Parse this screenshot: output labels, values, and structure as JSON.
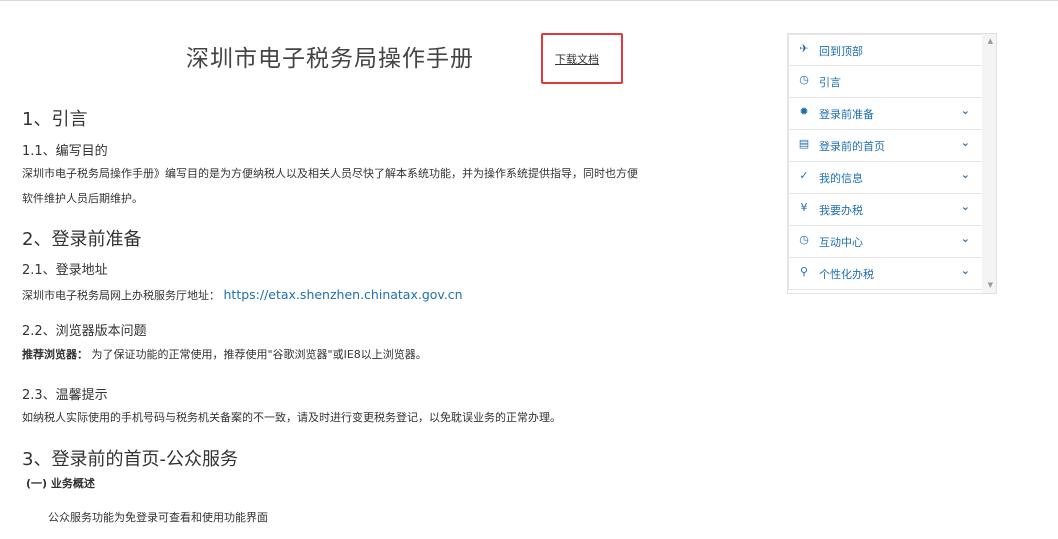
{
  "doc": {
    "title": "深圳市电子税务局操作手册",
    "download_label": "下载文档"
  },
  "sections": {
    "s1": "1、引言",
    "s1_1": "1.1、编写目的",
    "s1_1_text_line1": "深圳市电子税务局操作手册》编写目的是为方便纳税人以及相关人员尽快了解本系统功能，并为操作系统提供指导，同时也方便",
    "s1_1_text_line2": "软件维护人员后期维护。",
    "s2": "2、登录前准备",
    "s2_1": "2.1、登录地址",
    "s2_1_prefix": "深圳市电子税务局网上办税服务厅地址：",
    "s2_1_url": "https://etax.shenzhen.chinatax.gov.cn",
    "s2_2": "2.2、浏览器版本问题",
    "s2_2_label": "推荐浏览器：",
    "s2_2_text": "为了保证功能的正常使用，推荐使用\"谷歌浏览器\"或IE8以上浏览器。",
    "s2_3": "2.3、温馨提示",
    "s2_3_text": "如纳税人实际使用的手机号码与税务机关备案的不一致，请及时进行变更税务登记，以免耽误业务的正常办理。",
    "s3": "3、登录前的首页-公众服务",
    "s3_sub": "(一) 业务概述",
    "s3_text": "公众服务功能为免登录可查看和使用功能界面"
  },
  "nav": {
    "items": [
      {
        "label": "回到顶部",
        "icon": "plane-icon",
        "glyph": "✈",
        "has_chevron": false
      },
      {
        "label": "引言",
        "icon": "clock-icon",
        "glyph": "◷",
        "has_chevron": false
      },
      {
        "label": "登录前准备",
        "icon": "gear-icon",
        "glyph": "✹",
        "has_chevron": true
      },
      {
        "label": "登录前的首页",
        "icon": "list-icon",
        "glyph": "▤",
        "has_chevron": true
      },
      {
        "label": "我的信息",
        "icon": "check-icon",
        "glyph": "✓",
        "has_chevron": true
      },
      {
        "label": "我要办税",
        "icon": "yen-icon",
        "glyph": "¥",
        "has_chevron": true
      },
      {
        "label": "互动中心",
        "icon": "clock-icon",
        "glyph": "◷",
        "has_chevron": true
      },
      {
        "label": "个性化办税",
        "icon": "search-icon",
        "glyph": "⚲",
        "has_chevron": true
      }
    ],
    "chevron_glyph": "⌄"
  },
  "colors": {
    "accent": "#1f6fb0",
    "highlight_border": "#e23a3a"
  }
}
